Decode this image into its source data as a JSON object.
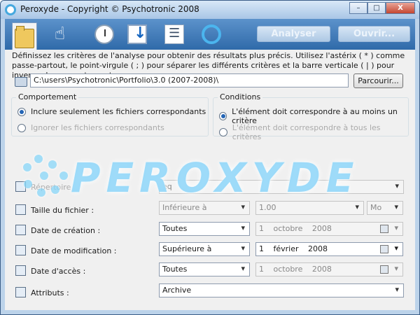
{
  "window": {
    "title": "Peroxyde - Copyright © Psychotronic 2008",
    "minimize": "–",
    "maximize": "□",
    "close": "X"
  },
  "toolbar": {
    "analyse": "Analyser",
    "open": "Ouvrir..."
  },
  "description": "Définissez les critères de l'analyse pour obtenir des résultats plus précis. Utilisez l'astérix ( * ) comme passe-partout, le point-virgule ( ; ) pour séparer les différents critères et la barre verticale ( | ) pour inverser le comportement.",
  "path": {
    "value": "C:\\users\\Psychotronic\\Portfolio\\3.0 (2007-2008)\\",
    "browse": "Parcourir..."
  },
  "behaviour": {
    "legend": "Comportement",
    "include": "Inclure seulement les fichiers correspondants",
    "ignore": "Ignorer les fichiers correspondants"
  },
  "conditions": {
    "legend": "Conditions",
    "one": "L'élément doit correspondre à au moins un critère",
    "all": "L'élément doit correspondre à tous les critères"
  },
  "banner": {
    "word": "PEROXYDE"
  },
  "criteria": {
    "directory": {
      "label": "Répertoire :",
      "value": "eq"
    },
    "size": {
      "label": "Taille du fichier :",
      "comparison": "Inférieure à",
      "value": "1.00",
      "unit": "Mo"
    },
    "created": {
      "label": "Date de création :",
      "comparison": "Toutes",
      "day": "1",
      "month": "octobre",
      "year": "2008"
    },
    "modified": {
      "label": "Date de modification :",
      "comparison": "Supérieure à",
      "day": "1",
      "month": "février",
      "year": "2008"
    },
    "accessed": {
      "label": "Date d'accès :",
      "comparison": "Toutes",
      "day": "1",
      "month": "octobre",
      "year": "2008"
    },
    "attributes": {
      "label": "Attributs :",
      "value": "Archive"
    }
  }
}
